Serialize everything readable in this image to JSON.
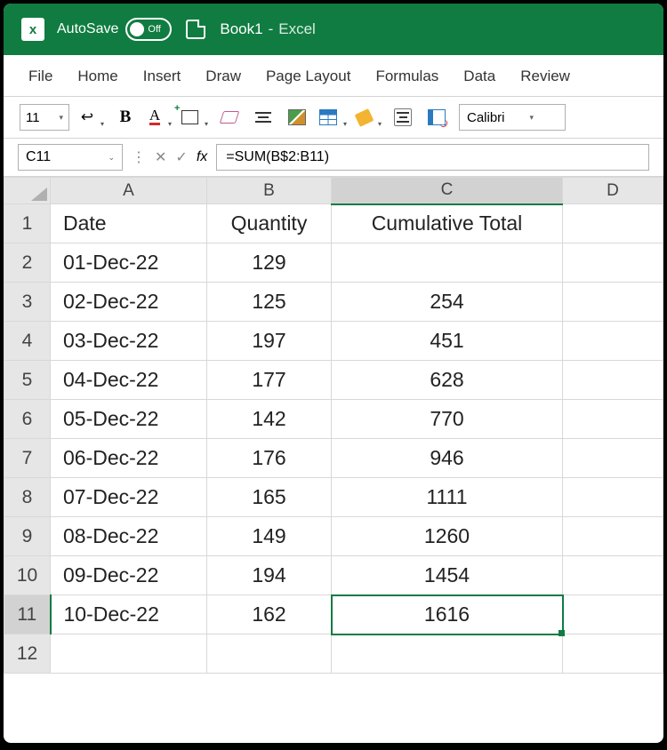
{
  "titlebar": {
    "autosave_label": "AutoSave",
    "autosave_state": "Off",
    "doc_name": "Book1",
    "dash": "-",
    "app_name": "Excel"
  },
  "ribbon": {
    "tabs": [
      "File",
      "Home",
      "Insert",
      "Draw",
      "Page Layout",
      "Formulas",
      "Data",
      "Review"
    ]
  },
  "toolbar": {
    "font_size": "11",
    "font_name": "Calibri"
  },
  "formula_bar": {
    "name_box": "C11",
    "fx_label": "fx",
    "formula": "=SUM(B$2:B11)"
  },
  "sheet": {
    "cols": [
      "A",
      "B",
      "C",
      "D"
    ],
    "selected_col": "C",
    "selected_row": "11",
    "headers": {
      "A": "Date",
      "B": "Quantity",
      "C": "Cumulative Total"
    },
    "rows": [
      {
        "n": "1",
        "A": "Date",
        "B": "Quantity",
        "C": "Cumulative Total"
      },
      {
        "n": "2",
        "A": "01-Dec-22",
        "B": "129",
        "C": ""
      },
      {
        "n": "3",
        "A": "02-Dec-22",
        "B": "125",
        "C": "254"
      },
      {
        "n": "4",
        "A": "03-Dec-22",
        "B": "197",
        "C": "451"
      },
      {
        "n": "5",
        "A": "04-Dec-22",
        "B": "177",
        "C": "628"
      },
      {
        "n": "6",
        "A": "05-Dec-22",
        "B": "142",
        "C": "770"
      },
      {
        "n": "7",
        "A": "06-Dec-22",
        "B": "176",
        "C": "946"
      },
      {
        "n": "8",
        "A": "07-Dec-22",
        "B": "165",
        "C": "1111"
      },
      {
        "n": "9",
        "A": "08-Dec-22",
        "B": "149",
        "C": "1260"
      },
      {
        "n": "10",
        "A": "09-Dec-22",
        "B": "194",
        "C": "1454"
      },
      {
        "n": "11",
        "A": "10-Dec-22",
        "B": "162",
        "C": "1616"
      },
      {
        "n": "12",
        "A": "",
        "B": "",
        "C": ""
      }
    ]
  }
}
